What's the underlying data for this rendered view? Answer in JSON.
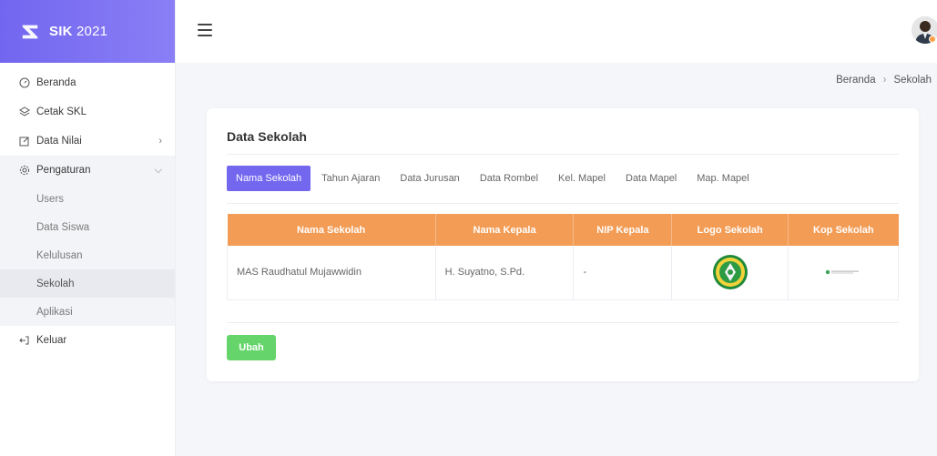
{
  "app": {
    "brand_name": "SIK",
    "brand_year": "2021"
  },
  "sidebar": {
    "items": [
      {
        "label": "Beranda",
        "icon": "gauge-icon"
      },
      {
        "label": "Cetak SKL",
        "icon": "layers-icon"
      },
      {
        "label": "Data Nilai",
        "icon": "edit-icon"
      },
      {
        "label": "Pengaturan",
        "icon": "gear-icon"
      },
      {
        "label": "Keluar",
        "icon": "logout-icon"
      }
    ],
    "submenu": [
      "Users",
      "Data Siswa",
      "Kelulusan",
      "Sekolah",
      "Aplikasi"
    ]
  },
  "breadcrumb": {
    "home": "Beranda",
    "current": "Sekolah"
  },
  "card": {
    "title": "Data Sekolah",
    "tabs": [
      "Nama Sekolah",
      "Tahun Ajaran",
      "Data Jurusan",
      "Data Rombel",
      "Kel. Mapel",
      "Data Mapel",
      "Map. Mapel"
    ],
    "table": {
      "headers": [
        "Nama Sekolah",
        "Nama Kepala",
        "NIP Kepala",
        "Logo Sekolah",
        "Kop Sekolah"
      ],
      "row": {
        "nama_sekolah": "MAS Raudhatul Mujawwidin",
        "nama_kepala": "H. Suyatno, S.Pd.",
        "nip_kepala": "-"
      }
    },
    "button_label": "Ubah"
  },
  "colors": {
    "brand": "#7367f0",
    "table_header": "#f39c55",
    "button": "#65d46a",
    "status_dot": "#ff9f43"
  }
}
